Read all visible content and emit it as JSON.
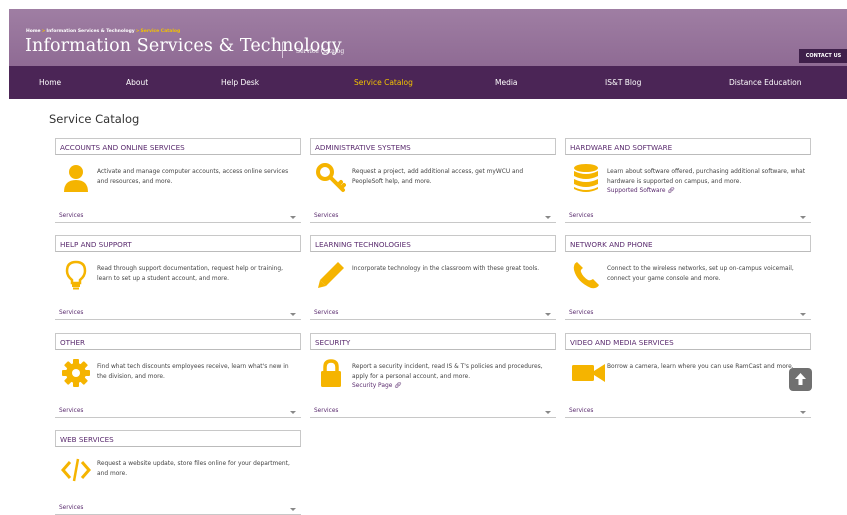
{
  "breadcrumb": {
    "home": "Home",
    "parent": "Information Services & Technology",
    "current": "Service Catalog"
  },
  "header": {
    "title": "Information Services & Technology",
    "subtitle": "Service Catalog",
    "contact_label": "CONTACT US"
  },
  "nav": {
    "items": [
      {
        "label": "Home"
      },
      {
        "label": "About"
      },
      {
        "label": "Help Desk"
      },
      {
        "label": "Service Catalog",
        "active": true
      },
      {
        "label": "Media"
      },
      {
        "label": "IS&T Blog"
      },
      {
        "label": "Distance Education"
      }
    ]
  },
  "page": {
    "heading": "Service Catalog"
  },
  "cards": [
    {
      "title": "ACCOUNTS AND ONLINE SERVICES",
      "icon": "user-icon",
      "desc": "Activate and manage computer accounts, access online services and resources, and more.",
      "link": "",
      "footer": "Services"
    },
    {
      "title": "ADMINISTRATIVE SYSTEMS",
      "icon": "key-icon",
      "desc": "Request a project, add additional access, get myWCU and PeopleSoft help, and more.",
      "link": "",
      "footer": "Services"
    },
    {
      "title": "HARDWARE AND SOFTWARE",
      "icon": "database-icon",
      "desc": "Learn about software offered, purchasing additional software, what hardware is supported on campus, and more.",
      "link": "Supported Software 🔗︎",
      "footer": "Services"
    },
    {
      "title": "HELP AND SUPPORT",
      "icon": "lightbulb-icon",
      "desc": "Read through support documentation, request help or training, learn to set up a student account, and more.",
      "link": "",
      "footer": "Services"
    },
    {
      "title": "LEARNING TECHNOLOGIES",
      "icon": "pencil-icon",
      "desc": "Incorporate technology in the classroom with these great tools.",
      "link": "",
      "footer": "Services"
    },
    {
      "title": "NETWORK AND PHONE",
      "icon": "phone-icon",
      "desc": "Connect to the wireless networks, set up on-campus voicemail, connect your game console and more.",
      "link": "",
      "footer": "Services"
    },
    {
      "title": "OTHER",
      "icon": "gear-icon",
      "desc": "Find what tech discounts employees receive, learn what's new in the division, and more.",
      "link": "",
      "footer": "Services"
    },
    {
      "title": "SECURITY",
      "icon": "lock-icon",
      "desc": "Report a security incident, read IS & T's policies and procedures, apply for a personal account, and more.",
      "link": "Security Page 🔗︎",
      "footer": "Services"
    },
    {
      "title": "VIDEO AND MEDIA SERVICES",
      "icon": "video-camera-icon",
      "desc": "Borrow a camera, learn where you can use RamCast and more.",
      "link": "",
      "footer": "Services"
    },
    {
      "title": "WEB SERVICES",
      "icon": "code-icon",
      "desc": "Request a website update, store files online for your department, and more.",
      "link": "",
      "footer": "Services"
    }
  ],
  "colors": {
    "header_bg": "#9f7ea3",
    "nav_bg": "#4b2556",
    "accent_gold": "#f2c200",
    "icon_yellow": "#f5b400",
    "link_purple": "#5a2b6e"
  },
  "scroll_top": {
    "icon": "arrow-up-icon"
  }
}
